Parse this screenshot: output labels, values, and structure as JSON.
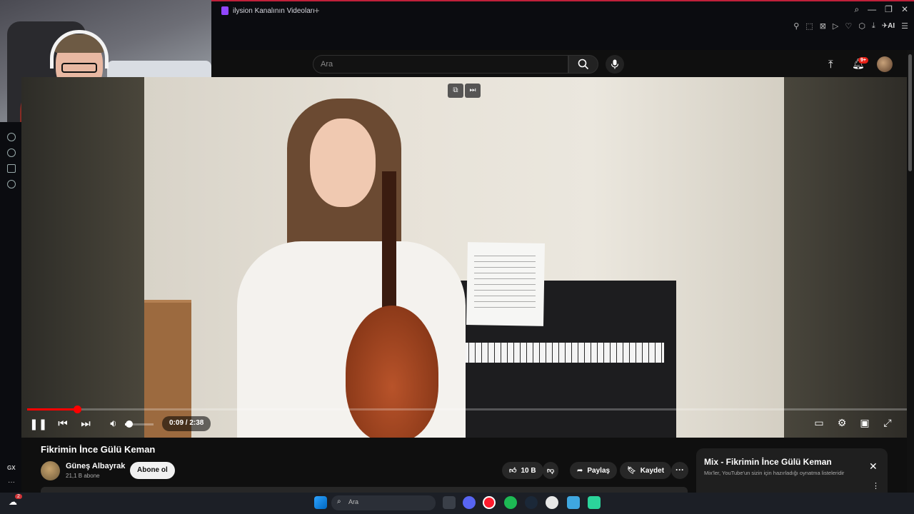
{
  "browser": {
    "tab_title": "ilysion Kanalının Videoları",
    "tab_add": "+",
    "toolbar_ai": "AI"
  },
  "youtube": {
    "search_placeholder": "Ara",
    "notifications_badge": "9+"
  },
  "player": {
    "current_time": "0:09",
    "duration": "2:38",
    "time_display": "0:09 / 2:38",
    "progress_fraction": 0.057,
    "volume_fraction": 0.15
  },
  "video": {
    "title": "Fikrimin İnce Gülü Keman",
    "channel_name": "Güneş Albayrak",
    "channel_subscribers": "21,1 B abone",
    "subscribe_label": "Abone ol",
    "like_count": "10 B",
    "share_label": "Paylaş",
    "save_label": "Kaydet"
  },
  "mix": {
    "title": "Mix - Fikrimin İnce Gülü Keman",
    "subtitle": "Mix'ler, YouTube'un sizin için hazırladığı oynatma listeleridir"
  },
  "sidebar": {
    "gx_label": "GX"
  },
  "taskbar": {
    "search_placeholder": "Ara",
    "notify_badge": "2"
  },
  "colors": {
    "accent": "#ff0000",
    "browser_accent": "#c0203a",
    "background": "#0f0f0f"
  }
}
